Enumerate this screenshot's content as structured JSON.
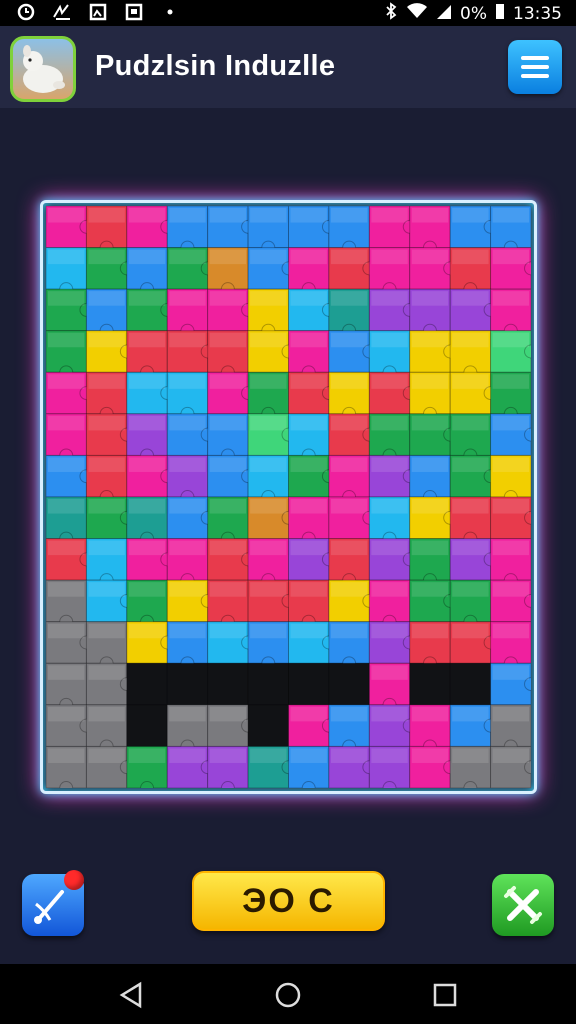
{
  "status_bar": {
    "battery_percent": "0%",
    "time": "13:35"
  },
  "header": {
    "title": "Pudzlsin Induzlle"
  },
  "board": {
    "cols": 12,
    "rows": 14,
    "palette": {
      "M": "#f0209e",
      "R": "#e83a4c",
      "B": "#2c8ff0",
      "C": "#22b8ef",
      "G": "#1ea84f",
      "g": "#3fd67a",
      "Y": "#f2cf00",
      "P": "#9845d8",
      "T": "#1d9e93",
      "O": "#d88a2a",
      "K": "#7a7a7e",
      "X": "#111215"
    },
    "grid": [
      "MRMBBBBBMMBB",
      "CGBGOBMRMMRM",
      "GBGMMYCTPPPM",
      "GYRRRYMBCYYg",
      "MRCCMGRYRYYG",
      "MRPBBgCRGGGB",
      "BRMPBCGMPBGY",
      "TGTBGOMMCYRR",
      "RCMMRMPRPGPM",
      "KCGYRRRYMGGM",
      "KKYBCBCBPRRM",
      "KKXXXXXXMXXB",
      "KKXKKXMBPMBK",
      "KKGPPTBPPMKK"
    ]
  },
  "controls": {
    "score_text": "ЭО С",
    "left_tool_icon": "wand-pin-icon",
    "right_tool_icon": "crossed-tools-icon"
  }
}
